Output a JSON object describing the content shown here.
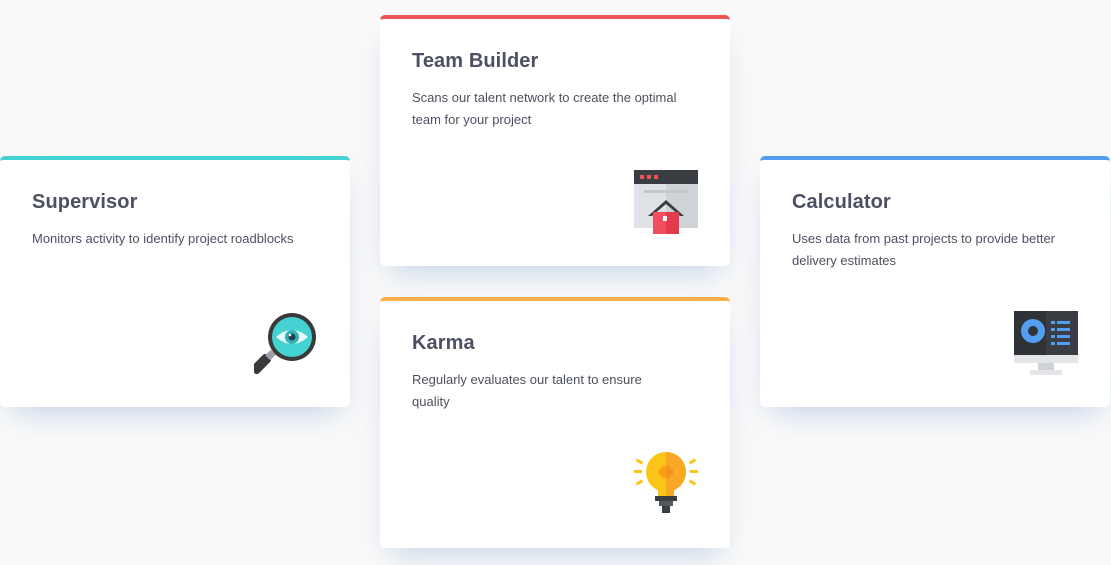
{
  "cards": [
    {
      "title": "Supervisor",
      "description": "Monitors activity to identify project roadblocks",
      "accent": "#44d3d2",
      "icon": "magnifier-eye-icon"
    },
    {
      "title": "Team Builder",
      "description": "Scans our talent network to create the optimal team for your project",
      "accent": "#ea5454",
      "icon": "browser-house-icon"
    },
    {
      "title": "Karma",
      "description": "Regularly evaluates our talent to ensure quality",
      "accent": "#fcaf4a",
      "icon": "lightbulb-icon"
    },
    {
      "title": "Calculator",
      "description": "Uses data from past projects to provide better delivery estimates",
      "accent": "#549ef2",
      "icon": "monitor-dashboard-icon"
    }
  ]
}
